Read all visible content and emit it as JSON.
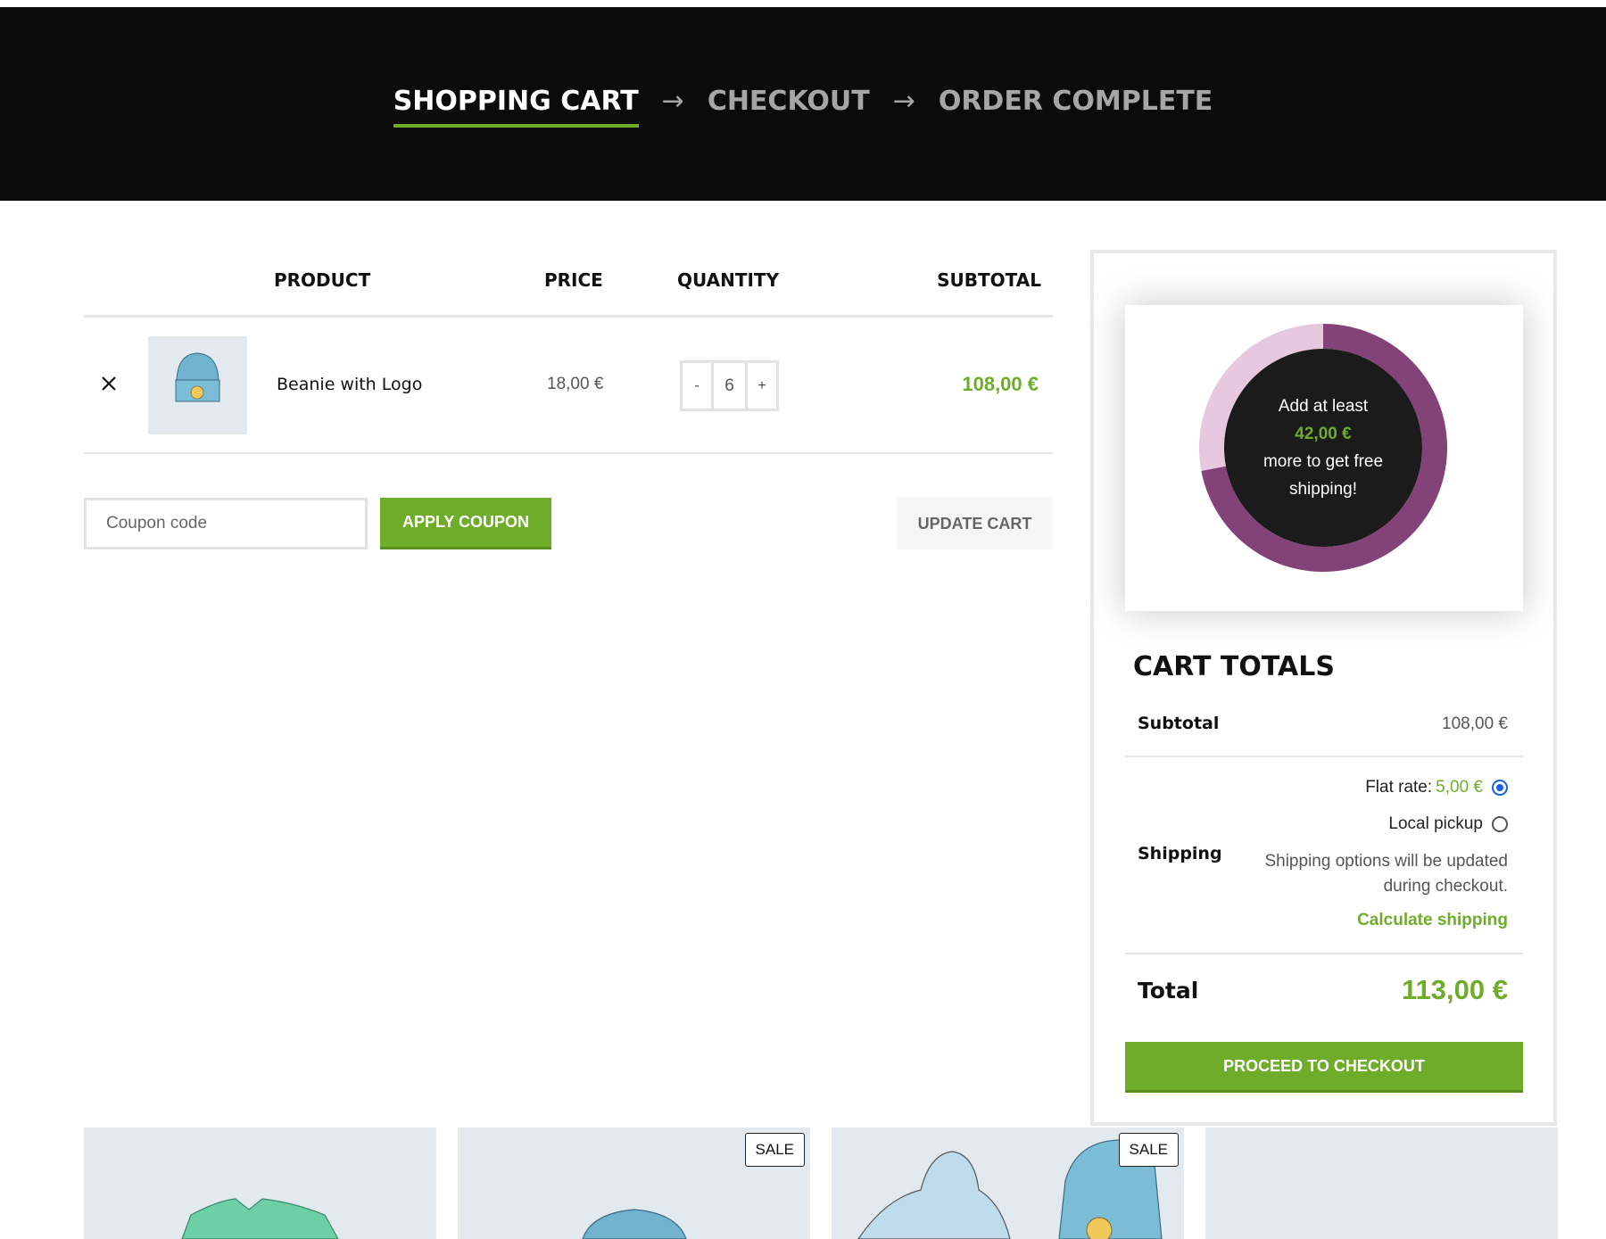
{
  "steps": [
    {
      "label": "SHOPPING CART",
      "active": true
    },
    {
      "label": "CHECKOUT",
      "active": false
    },
    {
      "label": "ORDER COMPLETE",
      "active": false
    }
  ],
  "step_arrow": "→",
  "table": {
    "headers": {
      "product": "PRODUCT",
      "price": "PRICE",
      "quantity": "QUANTITY",
      "subtotal": "SUBTOTAL"
    },
    "rows": [
      {
        "product": "Beanie with Logo",
        "price": "18,00 €",
        "quantity": "6",
        "subtotal": "108,00 €"
      }
    ],
    "qty_minus": "-",
    "qty_plus": "+"
  },
  "coupon": {
    "placeholder": "Coupon code",
    "value": "",
    "apply_label": "APPLY COUPON"
  },
  "update_label": "UPDATE CART",
  "free_shipping": {
    "line1": "Add at least",
    "amount": "42,00 €",
    "line2": "more to get free",
    "line3": "shipping!",
    "progress": 0.72,
    "colors": {
      "filled": "#834278",
      "remaining": "#e6c8df",
      "center": "#1b1b1b"
    }
  },
  "totals": {
    "title": "CART TOTALS",
    "subtotal_label": "Subtotal",
    "subtotal_value": "108,00 €",
    "shipping_label": "Shipping",
    "flat_rate_label": "Flat rate:",
    "flat_rate_value": "5,00 €",
    "flat_rate_selected": true,
    "local_pickup_label": "Local pickup",
    "local_pickup_selected": false,
    "shipping_note": "Shipping options will be updated during checkout.",
    "calculate_shipping": "Calculate shipping",
    "total_label": "Total",
    "total_value": "113,00 €",
    "checkout_label": "PROCEED TO CHECKOUT"
  },
  "related": [
    {
      "name": "v-neck-tshirt",
      "sale": false
    },
    {
      "name": "beanie",
      "sale": true,
      "badge": "SALE"
    },
    {
      "name": "hoodie-beanie-set",
      "sale": true,
      "badge": "SALE"
    },
    {
      "name": "empty",
      "sale": false
    }
  ],
  "colors": {
    "accent": "#6fac2a",
    "hero_bg": "#0b0b0b",
    "radio_selected": "#1a5fe8"
  }
}
